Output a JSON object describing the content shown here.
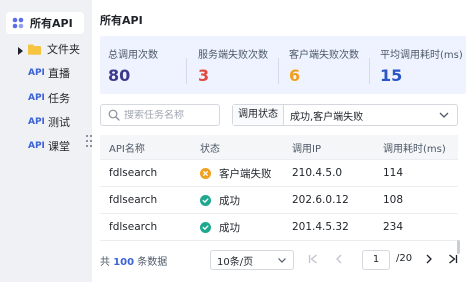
{
  "sidebar": {
    "items": [
      {
        "label": "所有API",
        "icon": "apps-icon"
      },
      {
        "label": "文件夹",
        "icon": "folder-icon"
      },
      {
        "label": "直播",
        "tag": "API"
      },
      {
        "label": "任务",
        "tag": "API"
      },
      {
        "label": "测试",
        "tag": "API"
      },
      {
        "label": "课堂",
        "tag": "API"
      }
    ]
  },
  "main": {
    "title": "所有API",
    "stats": [
      {
        "label": "总调用次数",
        "value": "80",
        "color": "#3d3a8c"
      },
      {
        "label": "服务端失败次数",
        "value": "3",
        "color": "#e04a3f"
      },
      {
        "label": "客户端失败次数",
        "value": "6",
        "color": "#f0a020"
      },
      {
        "label": "平均调用耗时(ms)",
        "value": "15",
        "color": "#2b54c7"
      }
    ],
    "search": {
      "placeholder": "搜索任务名称"
    },
    "filter": {
      "label": "调用状态",
      "value": "成功,客户端失败"
    },
    "table": {
      "headers": [
        "API名称",
        "状态",
        "调用IP",
        "调用耗时(ms)"
      ],
      "rows": [
        {
          "name": "fdlsearch",
          "status": "客户端失败",
          "status_type": "warning",
          "ip": "210.4.5.0",
          "time": "114"
        },
        {
          "name": "fdlsearch",
          "status": "成功",
          "status_type": "success",
          "ip": "202.6.0.12",
          "time": "108"
        },
        {
          "name": "fdlsearch",
          "status": "成功",
          "status_type": "success",
          "ip": "201.4.5.32",
          "time": "234"
        }
      ]
    },
    "footer": {
      "total_prefix": "共",
      "total_count": "100",
      "total_suffix": "条数据",
      "page_size": "10条/页",
      "current_page": "1",
      "total_pages": "/20"
    },
    "colors": {
      "warning": "#f0a020",
      "success": "#1fa88f",
      "accent": "#3b63d8"
    }
  }
}
